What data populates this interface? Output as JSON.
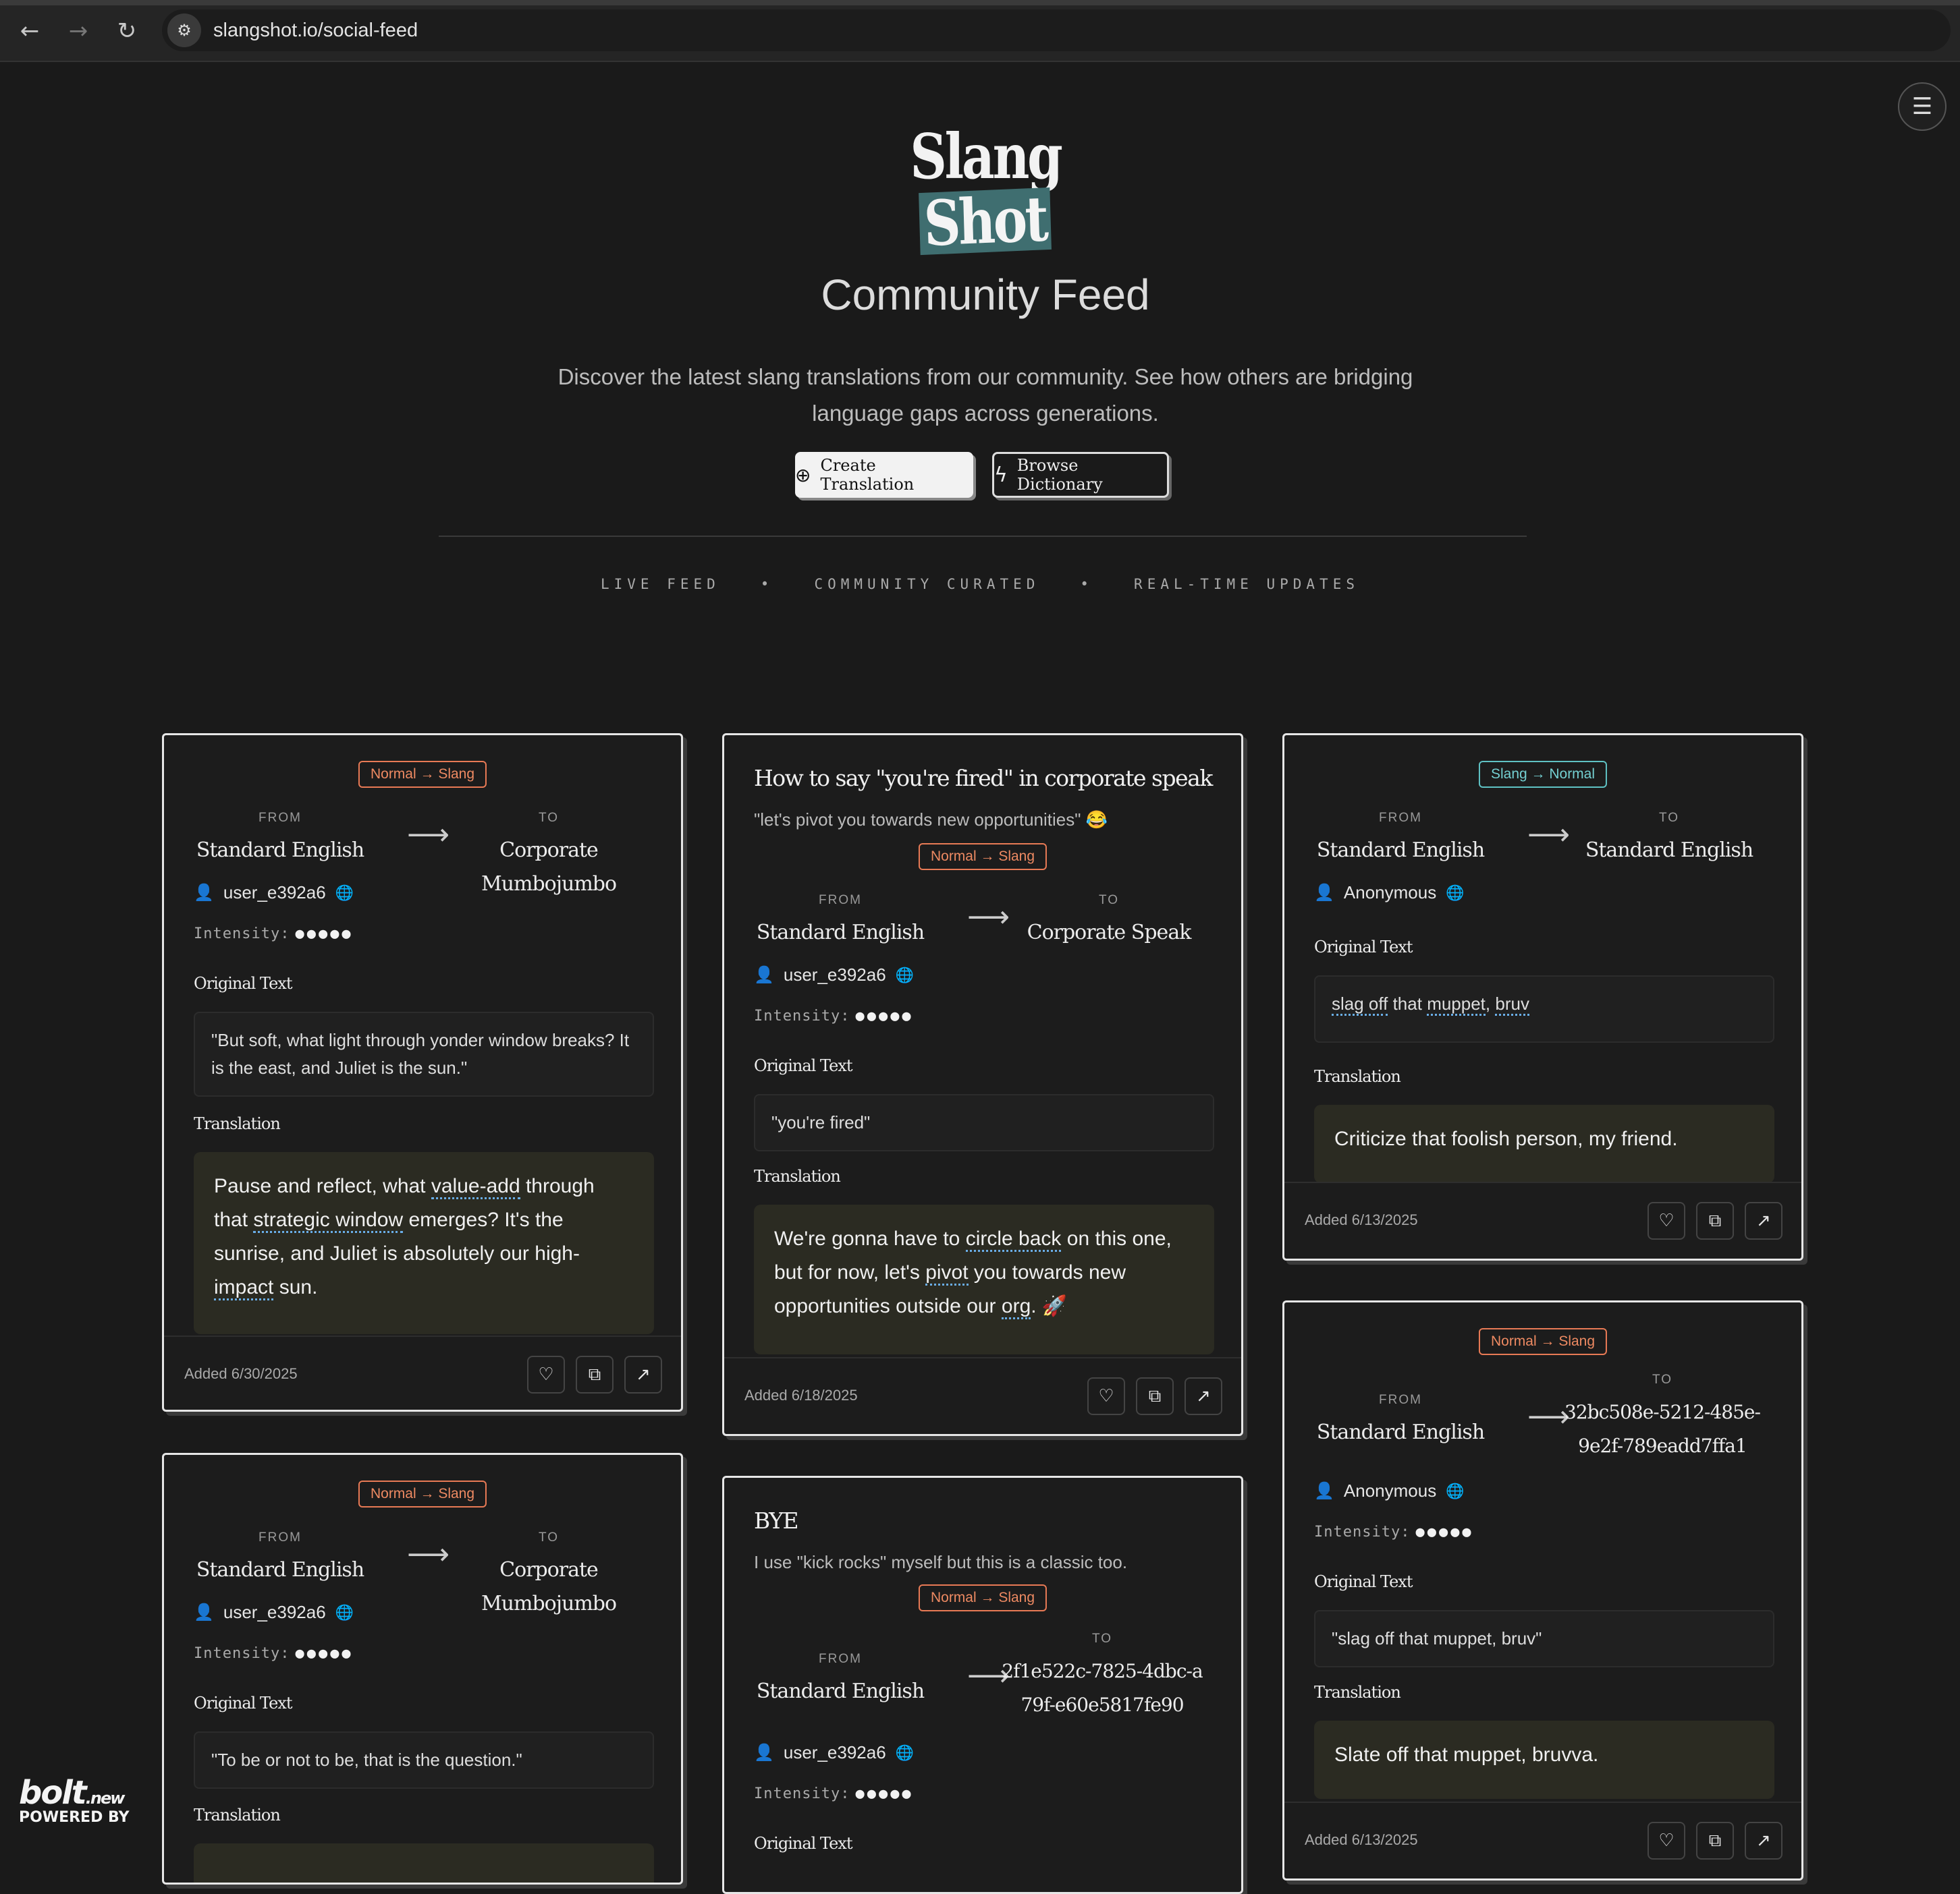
{
  "browser": {
    "url": "slangshot.io/social-feed",
    "back_icon": "←",
    "forward_icon": "→",
    "reload_icon": "↻",
    "site_info_icon": "⚙"
  },
  "header": {
    "logo_line1": "Slang",
    "logo_line2": "Shot",
    "title": "Community Feed",
    "description": "Discover the latest slang translations from our community. See how others are bridging language gaps across generations.",
    "create_button": "Create Translation",
    "browse_button": "Browse Dictionary",
    "tagline": [
      "LIVE FEED",
      "COMMUNITY CURATED",
      "REAL-TIME UPDATES"
    ],
    "separator": "•",
    "menu_icon": "☰"
  },
  "labels": {
    "from": "FROM",
    "to": "TO",
    "intensity": "Intensity:",
    "original_text": "Original Text",
    "translation": "Translation",
    "arrow": "⟶"
  },
  "cards": [
    {
      "badge": "Normal → Slang",
      "from": "Standard English",
      "to": "Corporate Mumbojumbo",
      "user": "user_e392a6",
      "intensity": "●●●●●",
      "original": "\"But soft, what light through yonder window breaks? It is the east, and Juliet is the sun.\"",
      "translation": "Pause and reflect, what value-add through that strategic window emerges? It's the sunrise, and Juliet is absolutely our high-impact sun.",
      "added": "Added 6/30/2025"
    },
    {
      "title": "How to say \"you're fired\" in corporate speak",
      "desc": "\"let's pivot you towards new opportunities\" 😂",
      "badge": "Normal → Slang",
      "from": "Standard English",
      "to": "Corporate Speak",
      "user": "user_e392a6",
      "intensity": "●●●●●",
      "original": "\"you're fired\"",
      "translation": "We're gonna have to circle back on this one, but for now, let's pivot you towards new opportunities outside our org. 🚀",
      "added": "Added 6/18/2025"
    },
    {
      "badge": "Slang → Normal",
      "from": "Standard English",
      "to": "Standard English",
      "user": "Anonymous",
      "original": "slag off that muppet, bruv",
      "translation": "Criticize that foolish person, my friend.",
      "added": "Added 6/13/2025"
    },
    {
      "badge": "Normal → Slang",
      "from": "Standard English",
      "to": "Corporate Mumbojumbo",
      "user": "user_e392a6",
      "intensity": "●●●●●",
      "original": "\"To be or not to be, that is the question.\""
    },
    {
      "title": "BYE",
      "desc": "I use \"kick rocks\" myself but this is a classic too.",
      "badge": "Normal → Slang",
      "from": "Standard English",
      "to": "2f1e522c-7825-4dbc-a79f-e60e5817fe90",
      "user": "user_e392a6",
      "intensity": "●●●●●"
    },
    {
      "badge": "Normal → Slang",
      "from": "Standard English",
      "to": "32bc508e-5212-485e-9e2f-789eadd7ffa1",
      "user": "Anonymous",
      "intensity": "●●●●●",
      "original": "\"slag off that muppet, bruv\"",
      "translation": "Slate off that muppet, bruvva.",
      "added": "Added 6/13/2025"
    }
  ],
  "icons": {
    "user": "👤",
    "globe": "🌐",
    "like": "♡",
    "copy": "⧉",
    "share": "↗",
    "plus_circle": "⊕",
    "bolt": "ϟ"
  },
  "branding": {
    "name": "bolt",
    "suffix": ".new",
    "powered": "POWERED BY"
  }
}
